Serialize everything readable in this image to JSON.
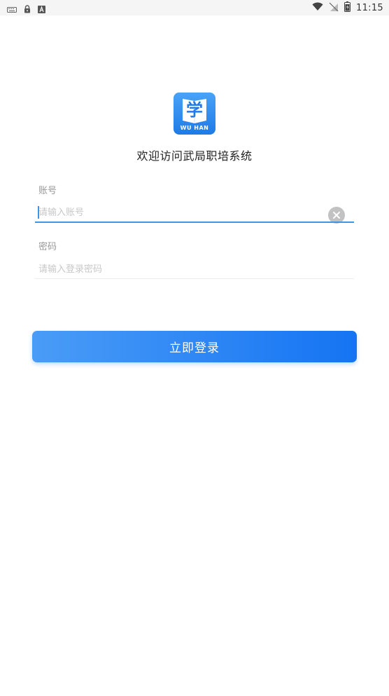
{
  "status_bar": {
    "time": "11:15",
    "left_icons": [
      "keyboard-icon",
      "lock-icon",
      "a-icon"
    ],
    "right_icons": [
      "wifi-icon",
      "no-sim-icon",
      "battery-icon"
    ]
  },
  "logo": {
    "glyph": "学",
    "caption": "WU HAN",
    "color": "#2f8cf0"
  },
  "welcome": "欢迎访问武局职培系统",
  "account": {
    "label": "账号",
    "placeholder": "请输入账号",
    "value": ""
  },
  "password": {
    "label": "密码",
    "placeholder": "请输入登录密码",
    "value": ""
  },
  "login_button": "立即登录",
  "colors": {
    "accent": "#3c95e8",
    "button_start": "#4a9cf6",
    "button_end": "#1574f3"
  }
}
